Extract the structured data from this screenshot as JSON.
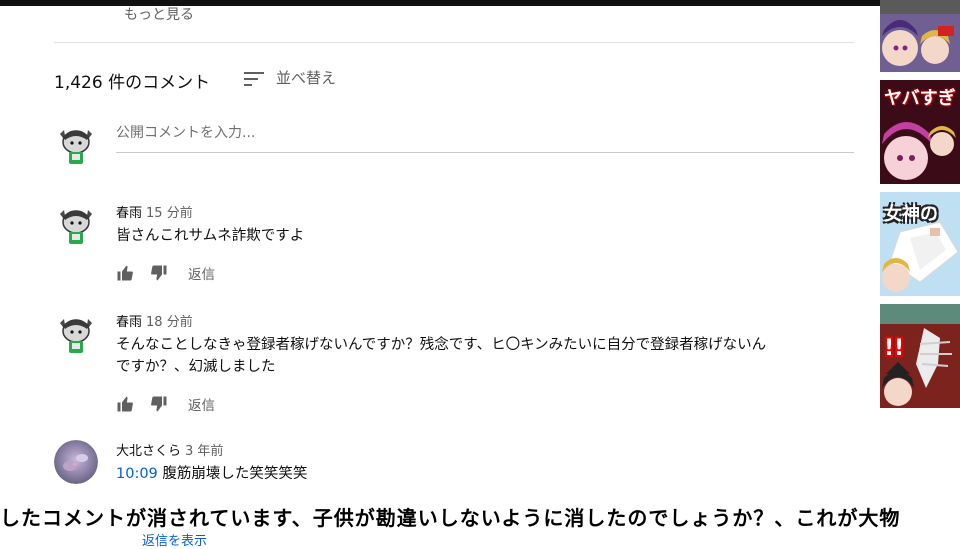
{
  "header": {
    "show_more": "もっと見る",
    "comment_count": "1,426 件のコメント",
    "sort_label": "並べ替え"
  },
  "input": {
    "placeholder": "公開コメントを入力..."
  },
  "comments": [
    {
      "author": "春雨",
      "time": "15 分前",
      "text": "皆さんこれサムネ詐欺ですよ",
      "reply": "返信"
    },
    {
      "author": "春雨",
      "time": "18 分前",
      "text_line1": "そんなことしなきゃ登録者稼げないんですか？残念です、ヒ〇キンみたいに自分で登録者稼げないん",
      "text_line2": "ですか？、幻滅しました",
      "reply": "返信"
    },
    {
      "author": "大北さくら",
      "time": "3 年前",
      "timestamp": "10:09",
      "text": "腹筋崩壊した笑笑笑笑"
    }
  ],
  "thumbnails": [
    {
      "text": ""
    },
    {
      "text": "ヤバすぎ"
    },
    {
      "text": "女神の"
    },
    {
      "text": "!!"
    }
  ],
  "subtitle": "したコメントが消されています、子供が勘違いしないように消したのでしょうか？、これが大物",
  "show_replies_partial": "返信を表示",
  "colors": {
    "link": "#065fd4",
    "muted": "#606060",
    "divider": "#e0e0e0"
  }
}
